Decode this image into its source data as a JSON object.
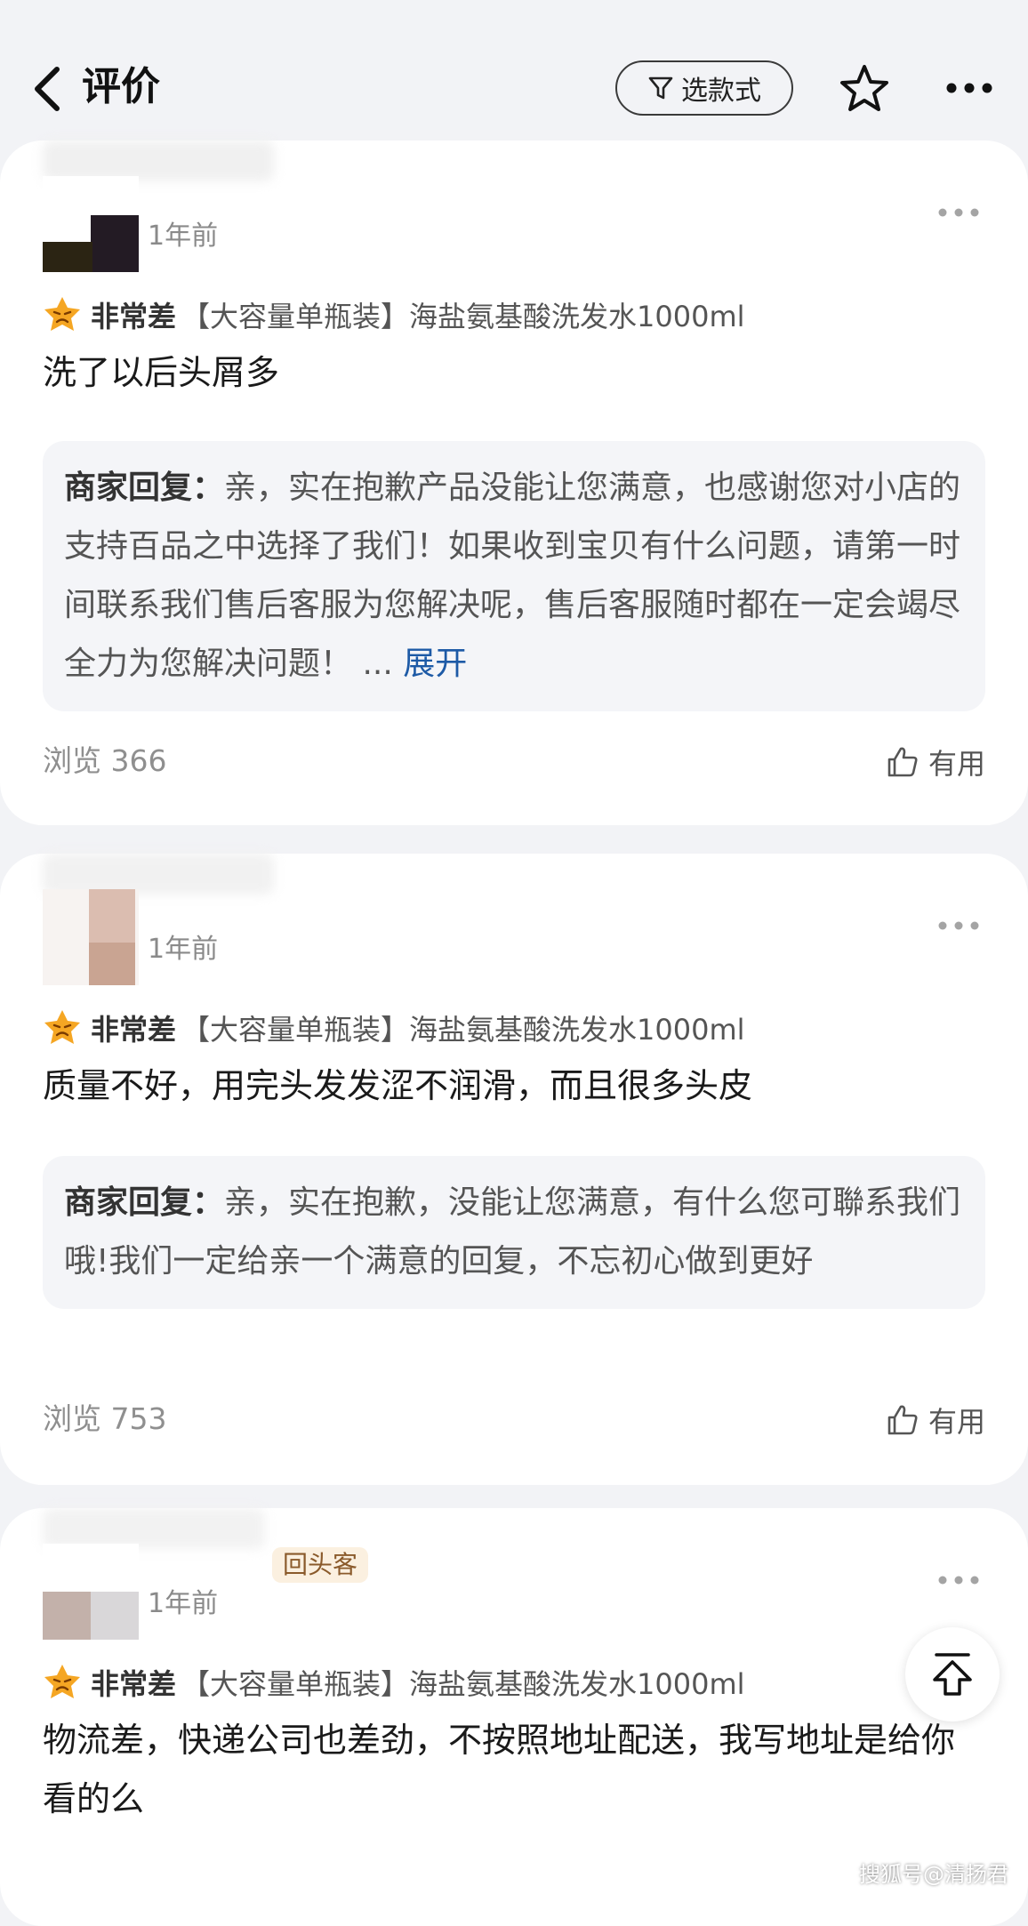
{
  "header": {
    "title": "评价",
    "filter_label": "选款式"
  },
  "reviews": [
    {
      "time": "1年前",
      "rating_label": "非常差",
      "sku": "【大容量单瓶装】海盐氨基酸洗发水1000ml",
      "text": "洗了以后头屑多",
      "reply_label": "商家回复：",
      "reply_text": "亲，实在抱歉产品没能让您满意，也感谢您对小店的支持百品之中选择了我们！如果收到宝贝有什么问题，请第一时间联系我们售后客服为您解决呢，售后客服随时都在一定会竭尽全力为您解决问题！",
      "reply_ellipsis": "...",
      "reply_expand": "展开",
      "views": "浏览 366",
      "useful": "有用"
    },
    {
      "time": "1年前",
      "rating_label": "非常差",
      "sku": "【大容量单瓶装】海盐氨基酸洗发水1000ml",
      "text": "质量不好，用完头发发涩不润滑，而且很多头皮",
      "reply_label": "商家回复：",
      "reply_text": "亲，实在抱歉，没能让您满意，有什么您可聯系我们哦!我们一定给亲一个满意的回复，不忘初心做到更好",
      "views": "浏览 753",
      "useful": "有用"
    },
    {
      "badge": "回头客",
      "time": "1年前",
      "rating_label": "非常差",
      "sku": "【大容量单瓶装】海盐氨基酸洗发水1000ml",
      "text": "物流差，快递公司也差劲，不按照地址配送，我写地址是给你看的么"
    }
  ],
  "watermark": "搜狐号@清扬君",
  "colors": {
    "background": "#f2f3f6",
    "card": "#ffffff",
    "reply_bg": "#f4f5f8",
    "expand_link": "#1d5aa6",
    "badge_bg": "#fbf0e0",
    "badge_text": "#8a5a2b",
    "rating_face": "#f5a623"
  },
  "icons": [
    "back-arrow-icon",
    "filter-icon",
    "star-icon",
    "more-icon",
    "thumbs-up-icon",
    "angry-face-icon",
    "back-to-top-icon"
  ]
}
